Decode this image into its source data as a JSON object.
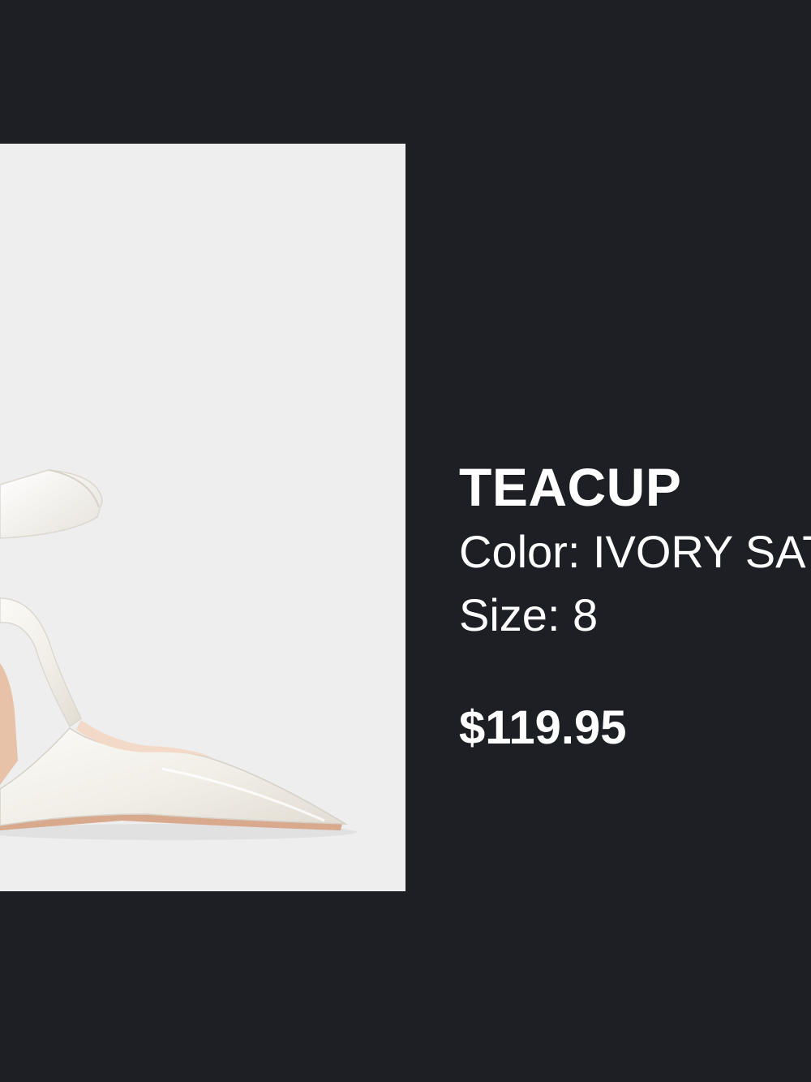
{
  "product": {
    "name": "TEACUP",
    "color_line": "Color: IVORY SATIN",
    "size_line": "Size: 8",
    "price": "$119.95",
    "image_subject": "ivory satin pointed-toe slingback heel with bow"
  },
  "colors": {
    "background": "#1e1f24",
    "photo_background": "#eeeeee",
    "text": "#ffffff"
  }
}
